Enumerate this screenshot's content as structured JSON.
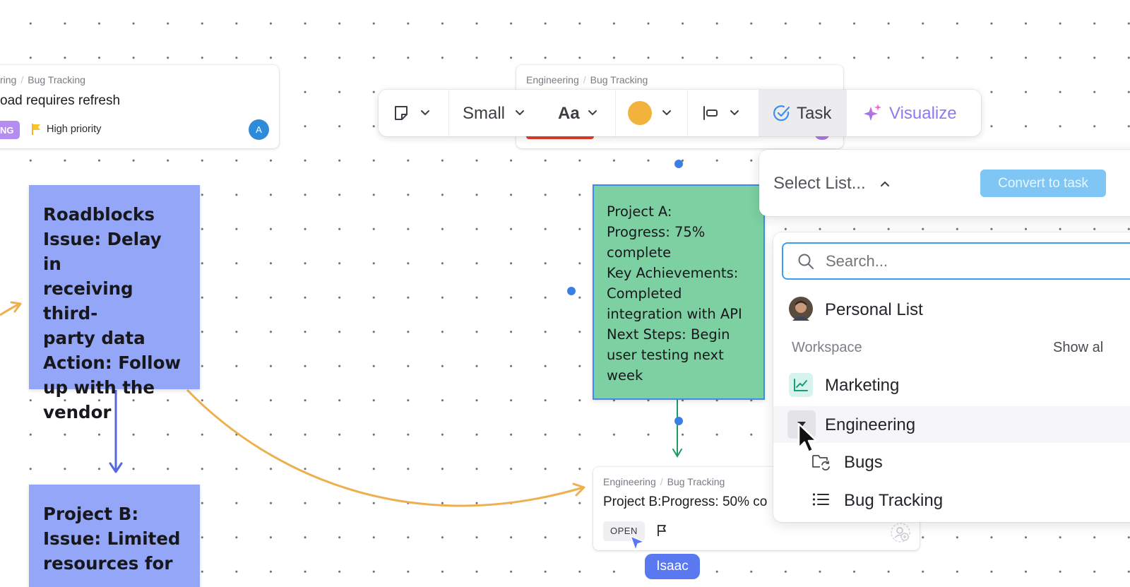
{
  "card_left": {
    "breadcrumb": [
      "ring",
      "Bug Tracking"
    ],
    "title": "oad requires refresh",
    "status": "NG",
    "priority": "High priority",
    "assignee_initial": "A"
  },
  "card_top": {
    "breadcrumb": [
      "Engineering",
      "Bug Tracking"
    ]
  },
  "card_bottom": {
    "breadcrumb": [
      "Engineering",
      "Bug Tracking"
    ],
    "title": "Project B:Progress: 50% co",
    "status": "OPEN"
  },
  "toolbar": {
    "size_label": "Small",
    "font_label": "Aa",
    "color": "#f2b33d",
    "task_label": "Task",
    "visualize_label": "Visualize"
  },
  "sticky_roadblocks": {
    "text": "Roadblocks\nIssue: Delay in\nreceiving third-\nparty data\nAction: Follow\nup with the\nvendor"
  },
  "sticky_project_b": {
    "text": "Project B:\nIssue: Limited\nresources for"
  },
  "sticky_project_a": {
    "text": "Project A:\nProgress: 75%\ncomplete\nKey Achievements:\nCompleted\nintegration with API\nNext Steps: Begin\nuser testing next\nweek"
  },
  "convert_panel": {
    "select_label": "Select List...",
    "convert_label": "Convert to task"
  },
  "list_dropdown": {
    "search_placeholder": "Search...",
    "personal_list": "Personal List",
    "workspace_label": "Workspace",
    "show_all": "Show al",
    "spaces": [
      {
        "label": "Marketing",
        "icon": "chart-line-icon"
      },
      {
        "label": "Engineering",
        "icon": "caret-down-icon"
      }
    ],
    "lists": [
      {
        "label": "Bugs",
        "icon": "folder-sync-icon"
      },
      {
        "label": "Bug Tracking",
        "icon": "list-icon"
      }
    ]
  },
  "collaborator": {
    "name": "Isaac"
  },
  "colors": {
    "sticky_blue": "#94a6f7",
    "sticky_green": "#7cd0a2",
    "arrow_orange": "#eeb04f",
    "arrow_blue": "#5568e0",
    "arrow_green": "#1f9a63",
    "accent_blue": "#3b8ef0"
  }
}
